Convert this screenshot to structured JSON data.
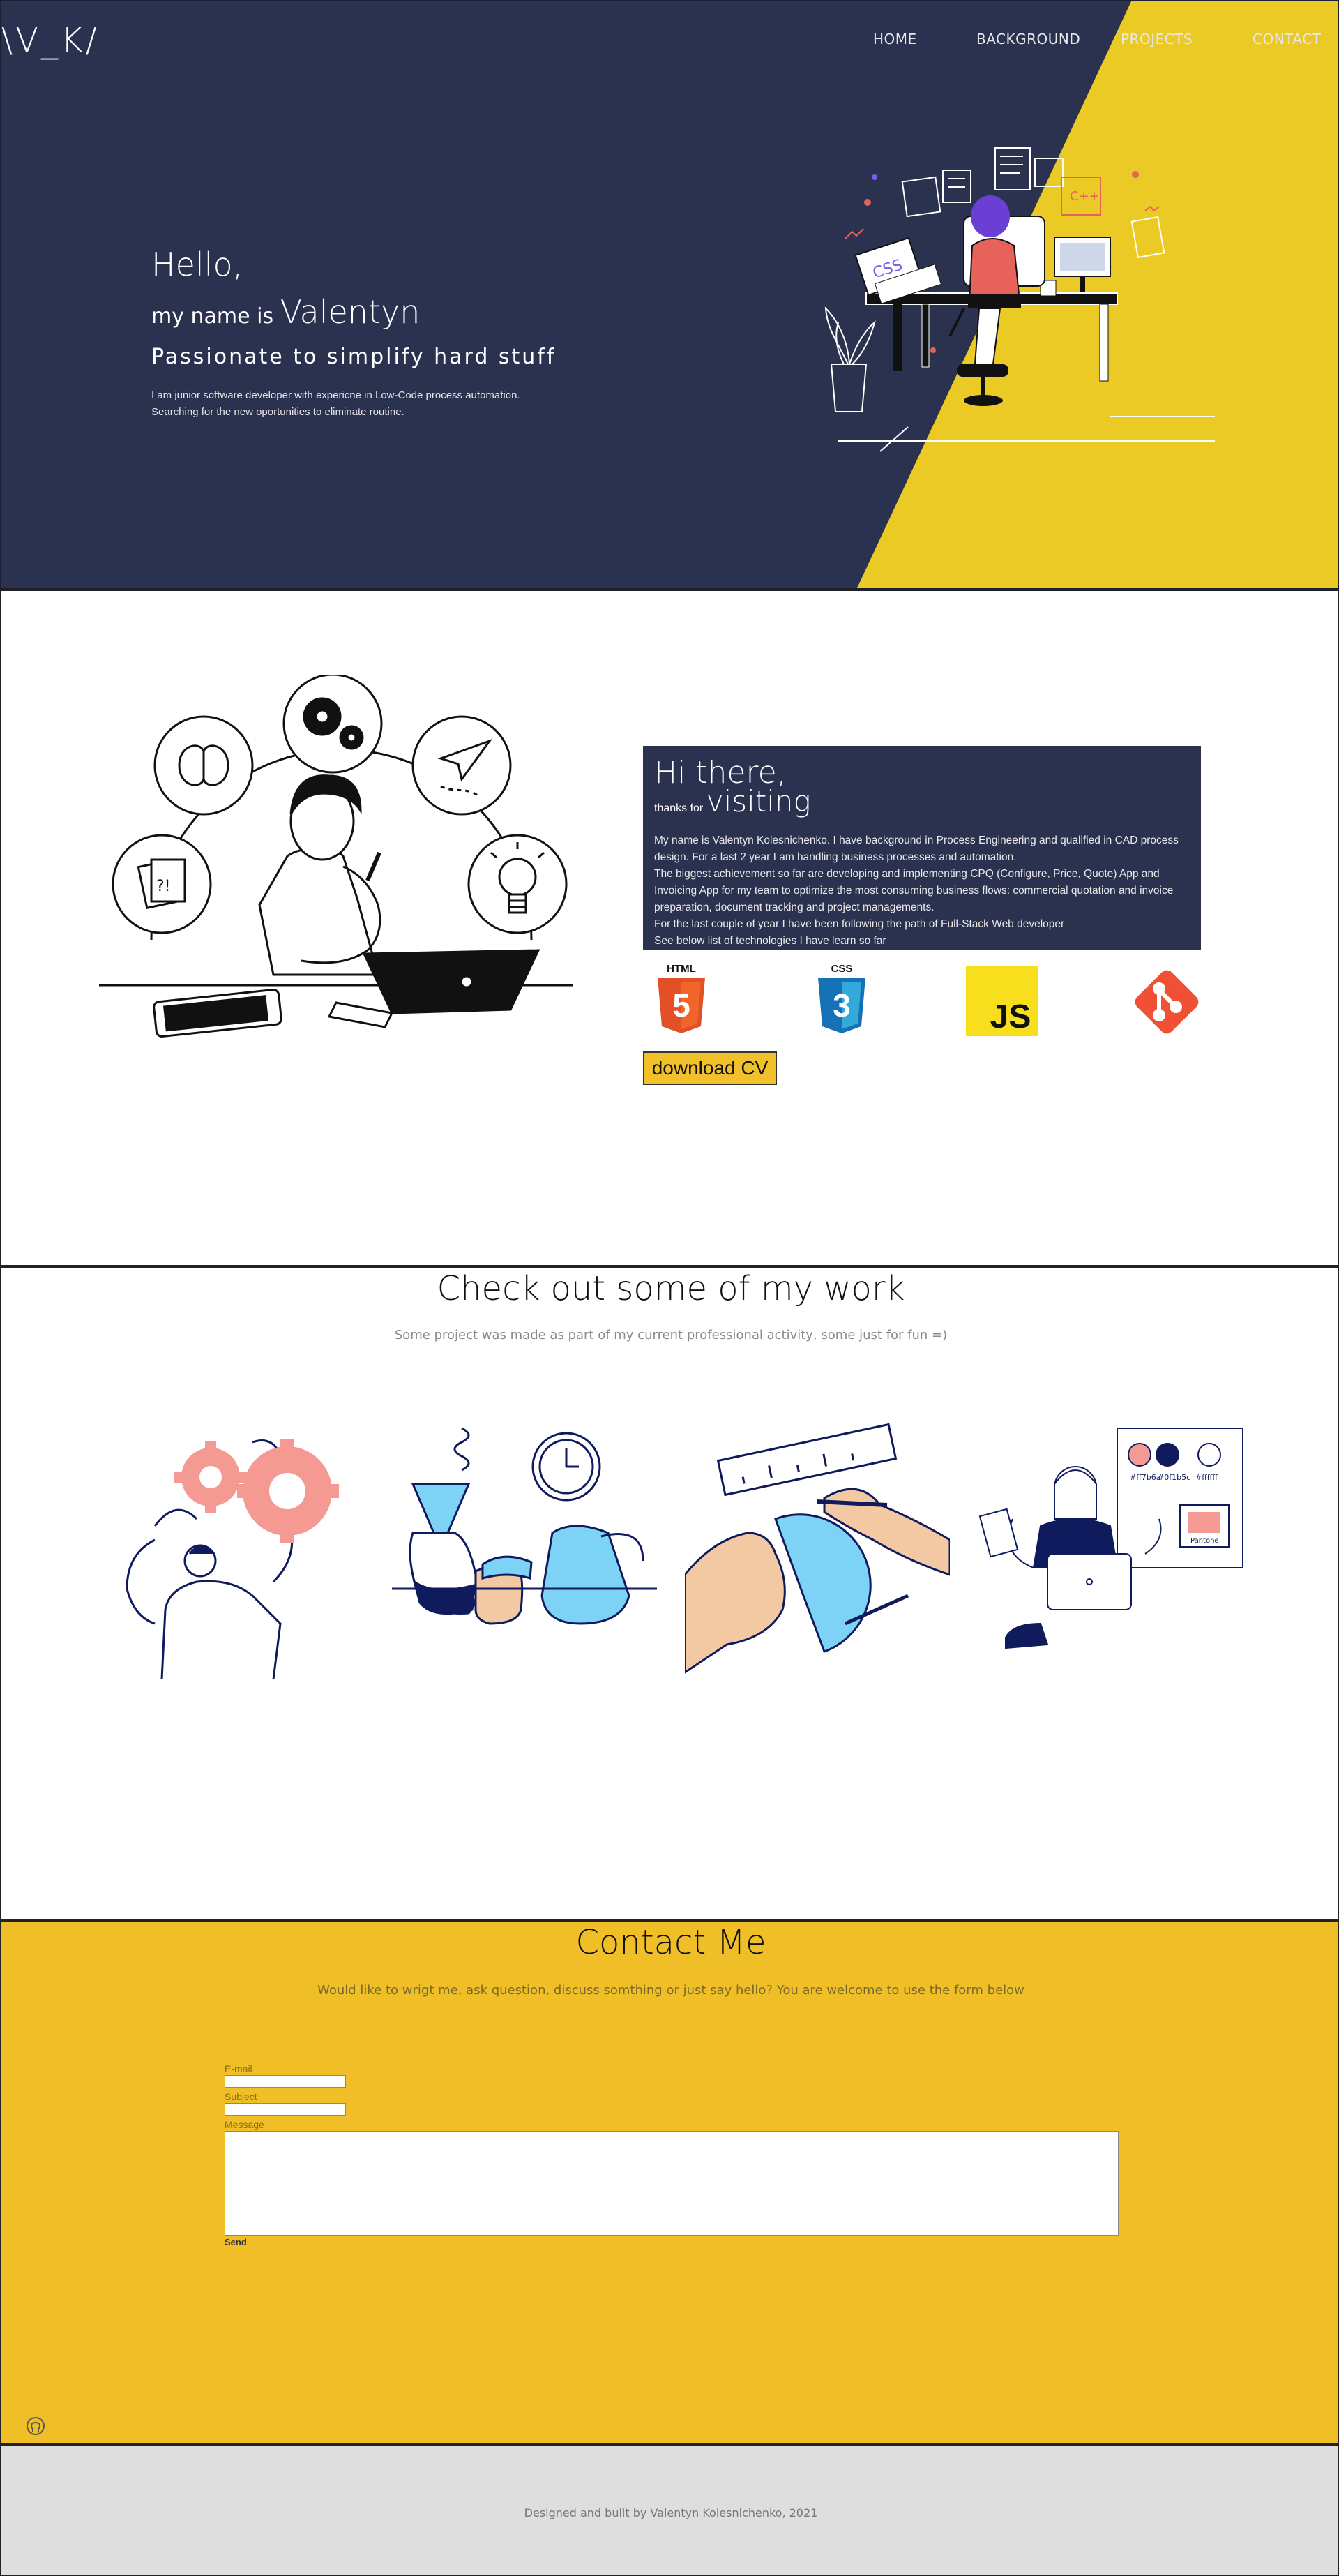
{
  "header": {
    "logo": "\\V_K/",
    "nav": [
      "HOME",
      "BACKGROUND",
      "PROJECTS",
      "CONTACT"
    ]
  },
  "hero": {
    "greeting": "Hello,",
    "name_prefix": "my name is",
    "name": "Valentyn",
    "tagline": "Passionate to simplify hard stuff",
    "intro_line1": "I am junior software developer with expericne in Low-Code process automation.",
    "intro_line2": "Searching for the new oportunities to eliminate routine.",
    "illustration_labels": [
      "CSS",
      "C++"
    ]
  },
  "about": {
    "title": "Hi there,",
    "thanks_prefix": "thanks for",
    "thanks_word": "visiting",
    "p1": "My name is Valentyn Kolesnichenko. I have background in Process Engineering and qualified in CAD process design. For a last 2 year I am handling business processes and automation.",
    "p2": "The biggest achievement so far are developing and implementing CPQ (Configure, Price, Quote) App and Invoicing App for my team to optimize the most consuming business flows: commercial quotation and invoice preparation, document tracking and project managements.",
    "p3": "For the last couple of year I have been following the path of Full-Stack Web developer",
    "p4": "See below list of technologies I have learn so far",
    "tech": [
      "HTML",
      "CSS",
      "JS"
    ],
    "cv_button": "download CV",
    "illustration_label": "?!"
  },
  "projects": {
    "title": "Check out some of my work",
    "subtitle": "Some project was made as part of my current professional activity, some just for fun =)",
    "palette_labels": [
      "#ff7b6a",
      "#0f1b5c",
      "#ffffff"
    ],
    "palette_note": "Pantone"
  },
  "contact": {
    "title": "Contact Me",
    "subtitle": "Would like to wrigt me, ask question, discuss somthing or just say hello? You are welcome to use the form below",
    "email_label": "E-mail",
    "subject_label": "Subject",
    "message_label": "Message",
    "send_label": "Send"
  },
  "footer": {
    "text": "Designed and built by Valentyn Kolesnichenko, 2021",
    "social_icons": [
      "github-icon",
      "linkedin-icon",
      "gmail-icon",
      "instagram-icon"
    ]
  },
  "colors": {
    "navy": "#2b3250",
    "yellow": "#f0bf28",
    "footer": "#dedede"
  }
}
